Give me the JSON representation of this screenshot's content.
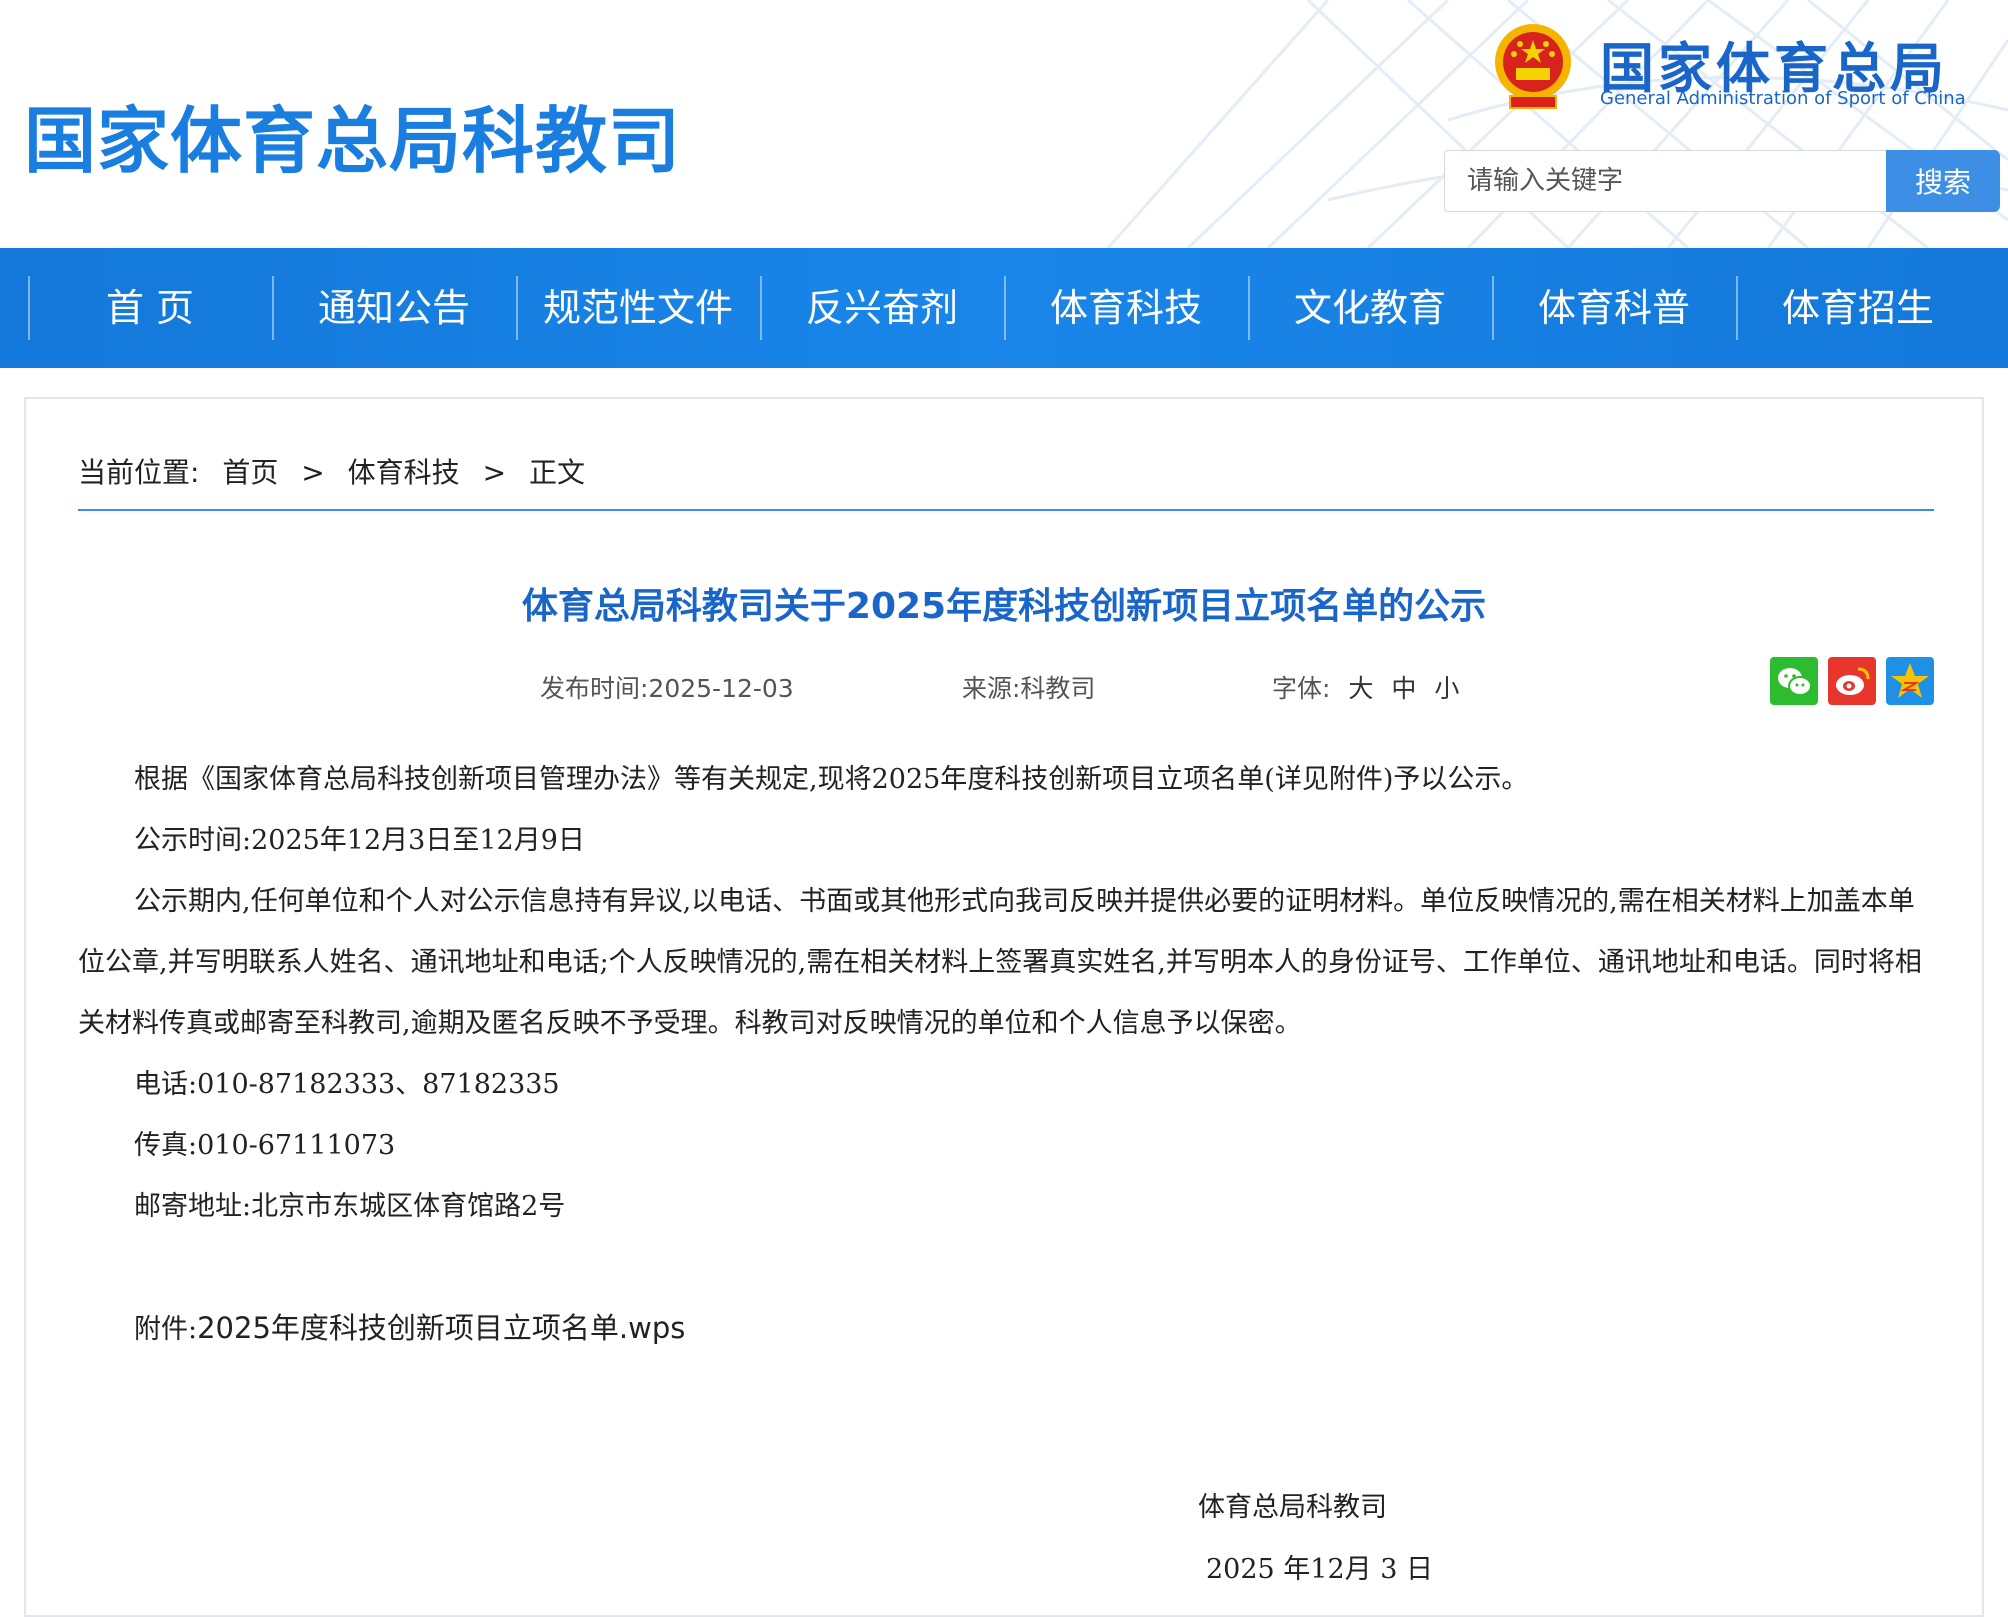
{
  "header": {
    "site_title": "国家体育总局科教司",
    "brand_cn": "国家体育总局",
    "brand_en": "General Administration of Sport of China",
    "search_placeholder": "请输入关键字",
    "search_button": "搜索"
  },
  "nav": {
    "items": [
      {
        "label": "首 页"
      },
      {
        "label": "通知公告"
      },
      {
        "label": "规范性文件"
      },
      {
        "label": "反兴奋剂"
      },
      {
        "label": "体育科技"
      },
      {
        "label": "文化教育"
      },
      {
        "label": "体育科普"
      },
      {
        "label": "体育招生"
      }
    ]
  },
  "breadcrumb": {
    "prefix": "当前位置:",
    "items": [
      "首页",
      ">",
      "体育科技",
      ">",
      "正文"
    ]
  },
  "article": {
    "title": "体育总局科教司关于2025年度科技创新项目立项名单的公示",
    "publish_time": "发布时间:2025-12-03",
    "source": "来源:科教司",
    "font_label": "字体:",
    "font_sizes": [
      "大",
      "中",
      "小"
    ],
    "paragraphs": [
      "根据《国家体育总局科技创新项目管理办法》等有关规定,现将2025年度科技创新项目立项名单(详见附件)予以公示。",
      "公示时间:2025年12月3日至12月9日",
      "公示期内,任何单位和个人对公示信息持有异议,以电话、书面或其他形式向我司反映并提供必要的证明材料。单位反映情况的,需在相关材料上加盖本单位公章,并写明联系人姓名、通讯地址和电话;个人反映情况的,需在相关材料上签署真实姓名,并写明本人的身份证号、工作单位、通讯地址和电话。同时将相关材料传真或邮寄至科教司,逾期及匿名反映不予受理。科教司对反映情况的单位和个人信息予以保密。",
      "电话:010-87182333、87182335",
      "传真:010-67111073",
      "邮寄地址:北京市东城区体育馆路2号"
    ],
    "attachment_label": "附件:",
    "attachment_name": "2025年度科技创新项目立项名单.wps",
    "signature_org": "体育总局科教司",
    "signature_date": "2025 年12月 3 日"
  },
  "share": {
    "icons": [
      "wechat-icon",
      "weibo-icon",
      "qzone-icon"
    ],
    "colors": {
      "wechat": "#2dbb2f",
      "weibo": "#e8352d",
      "qzone": "#1e90e6"
    }
  },
  "colors": {
    "accent": "#1a7ee0",
    "nav_bg": "#1a86ea",
    "title": "#1a66c8"
  }
}
